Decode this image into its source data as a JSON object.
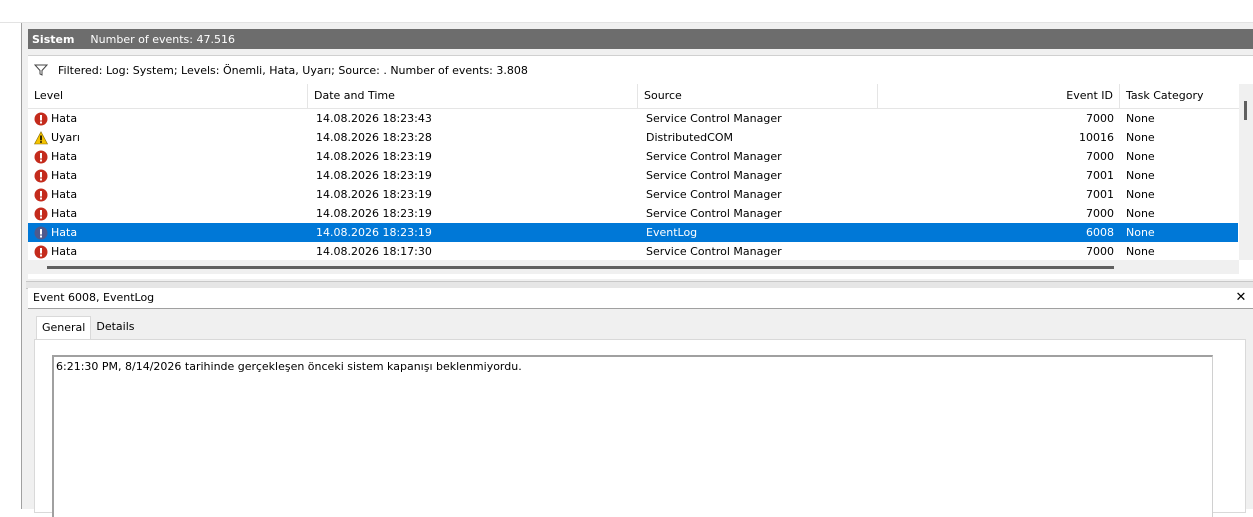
{
  "panel": {
    "title": "Sistem",
    "event_count": "Number of events: 47.516"
  },
  "filter": {
    "icon": "filter-icon",
    "text": "Filtered: Log: System; Levels: Önemli, Hata, Uyarı; Source: . Number of events: 3.808"
  },
  "columns": {
    "level": "Level",
    "datetime": "Date and Time",
    "source": "Source",
    "event_id": "Event ID",
    "task_category": "Task Category"
  },
  "events": [
    {
      "level": "Hata",
      "icon": "error-icon",
      "datetime": "14.08.2026 18:23:43",
      "source": "Service Control Manager",
      "event_id": "7000",
      "task_category": "None"
    },
    {
      "level": "Uyarı",
      "icon": "warning-icon",
      "datetime": "14.08.2026 18:23:28",
      "source": "DistributedCOM",
      "event_id": "10016",
      "task_category": "None"
    },
    {
      "level": "Hata",
      "icon": "error-icon",
      "datetime": "14.08.2026 18:23:19",
      "source": "Service Control Manager",
      "event_id": "7000",
      "task_category": "None"
    },
    {
      "level": "Hata",
      "icon": "error-icon",
      "datetime": "14.08.2026 18:23:19",
      "source": "Service Control Manager",
      "event_id": "7001",
      "task_category": "None"
    },
    {
      "level": "Hata",
      "icon": "error-icon",
      "datetime": "14.08.2026 18:23:19",
      "source": "Service Control Manager",
      "event_id": "7001",
      "task_category": "None"
    },
    {
      "level": "Hata",
      "icon": "error-icon",
      "datetime": "14.08.2026 18:23:19",
      "source": "Service Control Manager",
      "event_id": "7000",
      "task_category": "None"
    },
    {
      "level": "Hata",
      "icon": "error-icon",
      "datetime": "14.08.2026 18:23:19",
      "source": "EventLog",
      "event_id": "6008",
      "task_category": "None",
      "selected": true
    },
    {
      "level": "Hata",
      "icon": "error-icon",
      "datetime": "14.08.2026 18:17:30",
      "source": "Service Control Manager",
      "event_id": "7000",
      "task_category": "None"
    }
  ],
  "detail": {
    "title": "Event 6008, EventLog",
    "close_icon": "close-icon",
    "tabs": [
      {
        "label": "General",
        "active": true
      },
      {
        "label": "Details",
        "active": false
      }
    ],
    "message": "6:21:30 PM, 8/14/2026 tarihinde gerçekleşen önceki sistem kapanışı beklenmiyordu."
  },
  "colors": {
    "selection": "#0078d7",
    "titlebar": "#6d6d6d",
    "error": "#c42b1c",
    "warning": "#f5c400"
  }
}
